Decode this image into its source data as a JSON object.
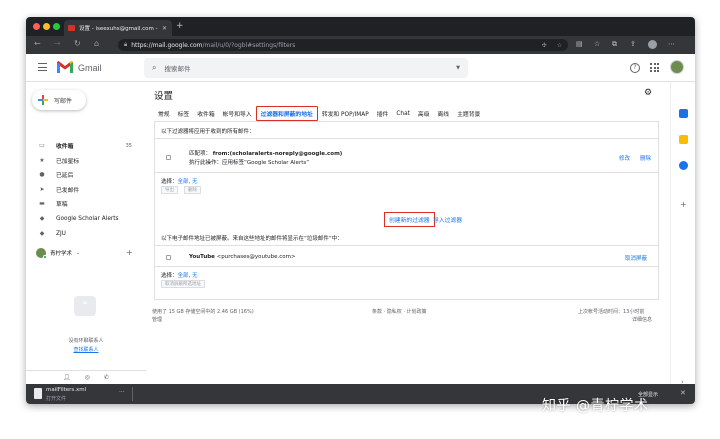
{
  "browser": {
    "tab_title": "设置 - iseexuhs@gmail.com -",
    "tab_close": "✕",
    "new_tab": "+",
    "url_host": "https://mail.google.com",
    "url_path": "/mail/u/0/?ogbl#settings/filters"
  },
  "header": {
    "app_name": "Gmail",
    "search_placeholder": "搜索邮件",
    "help": "?"
  },
  "sidebar": {
    "compose": "写邮件",
    "items": [
      {
        "label": "收件箱",
        "icon": "inbox-icon",
        "count": "35"
      },
      {
        "label": "已加星标",
        "icon": "star-icon",
        "count": ""
      },
      {
        "label": "已延后",
        "icon": "clock-icon",
        "count": ""
      },
      {
        "label": "已发邮件",
        "icon": "send-icon",
        "count": ""
      },
      {
        "label": "草稿",
        "icon": "draft-icon",
        "count": ""
      },
      {
        "label": "Google Scholar Alerts",
        "icon": "label-icon",
        "count": ""
      },
      {
        "label": "ZJU",
        "icon": "label-icon",
        "count": ""
      }
    ],
    "hangout_user": "青柠学术",
    "no_contacts": "没有环聊联系人",
    "find_contacts": "查找联系人"
  },
  "settings": {
    "title": "设置",
    "tabs": [
      "常规",
      "标签",
      "收件箱",
      "帐号和导入",
      "过滤器和屏蔽的地址",
      "转发和 POP/IMAP",
      "插件",
      "Chat",
      "高级",
      "离线",
      "主题背景"
    ],
    "active_tab": "过滤器和屏蔽的地址",
    "filters_heading": "以下过滤器将应用于收到的所有邮件：",
    "filter": {
      "match_label": "匹配项：",
      "match_value": "from:(scholaralerts-noreply@google.com)",
      "action": "执行此操作：应用标签“Google Scholar Alerts”",
      "edit": "修改",
      "delete": "删除"
    },
    "select_label": "选择：",
    "select_all": "全部",
    "select_none": "无",
    "export_btn": "导出",
    "delete_btn": "删除",
    "create_filter": "创建新的过滤器",
    "import_filter": "导入过滤器",
    "blocked_heading": "以下电子邮件地址已被屏蔽。来自这些地址的邮件将显示在“垃圾邮件”中：",
    "blocked": {
      "name": "YouTube",
      "email": "<purchases@youtube.com>",
      "unblock": "取消屏蔽"
    },
    "unblock_selected": "取消屏蔽所选地址"
  },
  "footer": {
    "storage": "使用了 15 GB 存储空间中的 2.46 GB (16%)",
    "manage": "管理",
    "links": "条款 · 隐私权 · 计划政策",
    "last_activity": "上次帐号活动时间：13小时前",
    "details": "详细信息"
  },
  "download": {
    "filename": "mailFilters.xml",
    "open": "打开文件",
    "more": "···",
    "show_all": "全部显示",
    "close": "✕"
  },
  "watermark": "知乎 @青柠学术"
}
